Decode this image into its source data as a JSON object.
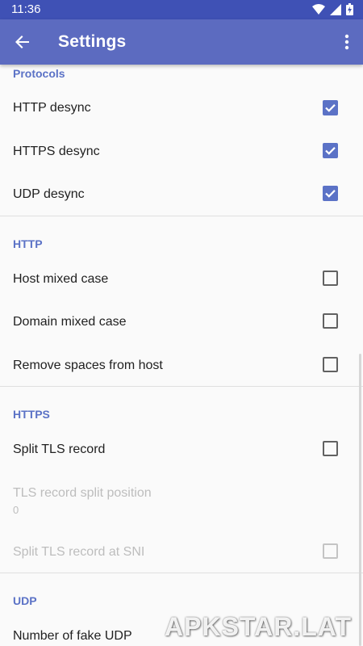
{
  "status_bar": {
    "time": "11:36"
  },
  "app_bar": {
    "title": "Settings"
  },
  "sections": [
    {
      "header": "Protocols",
      "items": [
        {
          "label": "HTTP desync",
          "checked": true
        },
        {
          "label": "HTTPS desync",
          "checked": true
        },
        {
          "label": "UDP desync",
          "checked": true
        }
      ]
    },
    {
      "header": "HTTP",
      "items": [
        {
          "label": "Host mixed case",
          "checked": false
        },
        {
          "label": "Domain mixed case",
          "checked": false
        },
        {
          "label": "Remove spaces from host",
          "checked": false
        }
      ]
    },
    {
      "header": "HTTPS",
      "items": [
        {
          "label": "Split TLS record",
          "checked": false
        },
        {
          "label": "TLS record split position",
          "value": "0",
          "enabled": false
        },
        {
          "label": "Split TLS record at SNI",
          "checked": false,
          "enabled": false
        }
      ]
    },
    {
      "header": "UDP",
      "items": [
        {
          "label": "Number of fake UDP"
        }
      ]
    }
  ],
  "watermark": "APKSTAR.LAT",
  "colors": {
    "status_bar": "#3f51b5",
    "app_bar": "#5c6bc0",
    "accent": "#5b72c6"
  }
}
